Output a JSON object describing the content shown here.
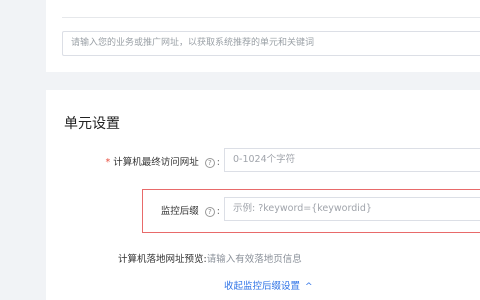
{
  "top_section": {
    "url_placeholder": "请输入您的业务或推广网址，以获取系统推荐的单元和关键词"
  },
  "unit_settings": {
    "title": "单元设置",
    "pc_final_url": {
      "required_mark": "*",
      "label": "计算机最终访问网址",
      "help_icon": "?",
      "colon": ":",
      "placeholder": "0-1024个字符"
    },
    "tracking_suffix": {
      "label": "监控后缀",
      "help_icon": "?",
      "colon": ":",
      "placeholder": "示例: ?keyword={keywordid}"
    },
    "landing_preview": {
      "label": "计算机落地网址预览:",
      "value": "请输入有效落地页信息"
    },
    "collapse_link": {
      "label": "收起监控后缀设置",
      "icon": "^"
    }
  },
  "colors": {
    "accent": "#2f73e6",
    "required": "#e74c3c",
    "highlight_border": "#e86a6a"
  }
}
